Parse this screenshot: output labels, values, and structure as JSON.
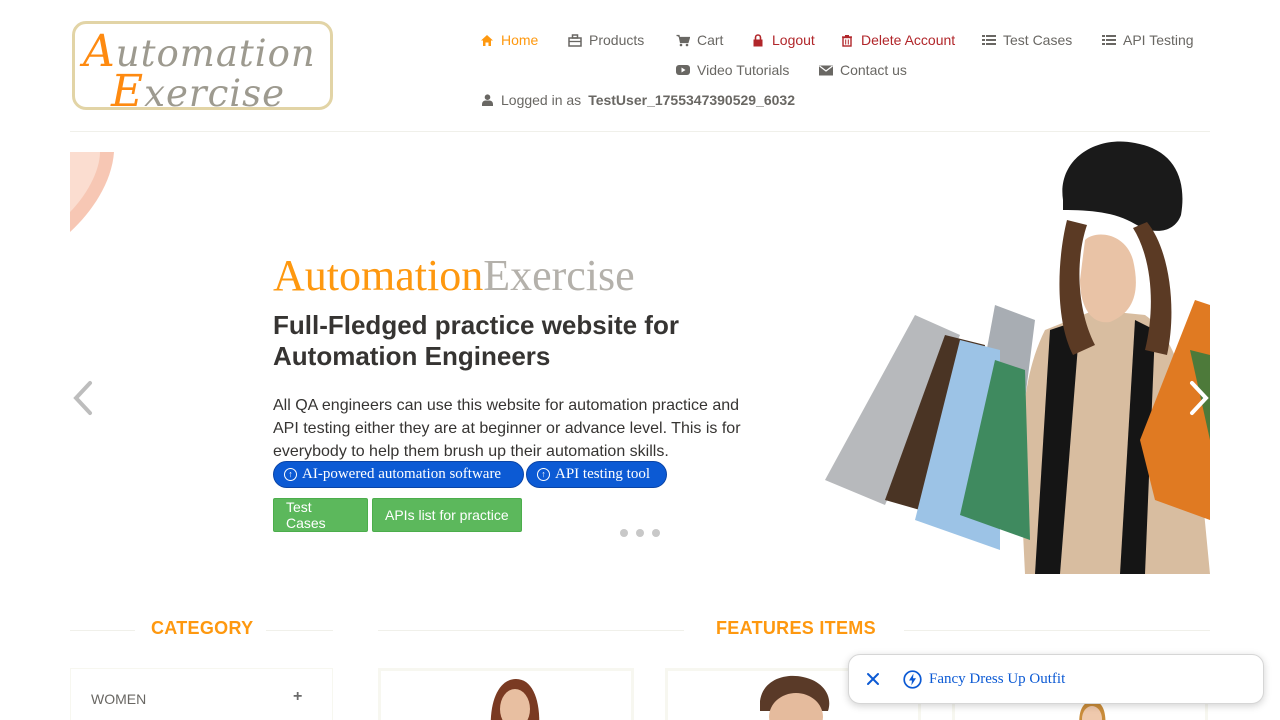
{
  "logo": {
    "line1_cap": "A",
    "line1_rest": "utomation",
    "line2_cap": "E",
    "line2_rest": "xercise"
  },
  "nav": {
    "home": "Home",
    "products": "Products",
    "cart": "Cart",
    "logout": "Logout",
    "delete_account": "Delete Account",
    "test_cases": "Test Cases",
    "api_testing": "API Testing",
    "video_tutorials": "Video Tutorials",
    "contact_us": "Contact us",
    "logged_in_prefix": "Logged in as",
    "username": "TestUser_1755347390529_6032"
  },
  "slider": {
    "brand_a": "Automation",
    "brand_e": "Exercise",
    "heading": "Full-Fledged practice website for Automation Engineers",
    "text": "All QA engineers can use this website for automation practice and API testing either they are at beginner or advance level. This is for everybody to help them brush up their automation skills.",
    "pill1": "AI-powered automation software",
    "pill2": "API testing tool",
    "btn_test_cases": "Test Cases",
    "btn_apis": "APIs list for practice",
    "slide_count": 3
  },
  "sections": {
    "category": "CATEGORY",
    "features": "FEATURES ITEMS"
  },
  "category": {
    "first_item": "WOMEN",
    "expand_symbol": "+"
  },
  "toast": {
    "text": "Fancy Dress Up Outfit"
  },
  "colors": {
    "accent": "#fe980f",
    "danger": "#b1262a",
    "green": "#5cb85c",
    "blue": "#0c5ad4"
  }
}
